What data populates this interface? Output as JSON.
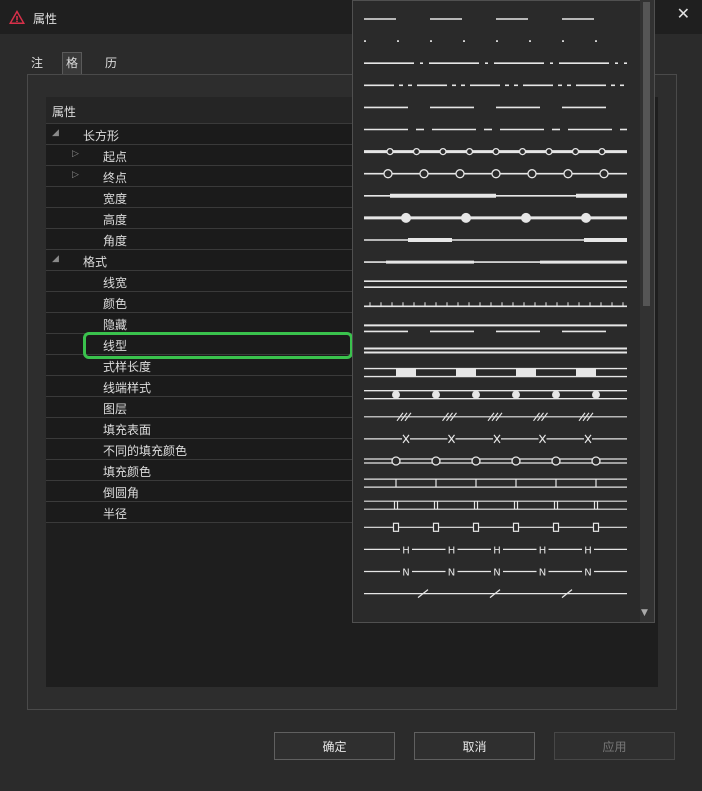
{
  "window": {
    "title": "属性",
    "close": "✕"
  },
  "tabs": [
    "注释",
    "格式",
    "历史记录"
  ],
  "grid": {
    "header": "属性",
    "rows": [
      {
        "label": "长方形",
        "indent": 0,
        "expander": "◢"
      },
      {
        "label": "起点",
        "indent": 1,
        "expander": "▷"
      },
      {
        "label": "终点",
        "indent": 1,
        "expander": "▷"
      },
      {
        "label": "宽度",
        "indent": 1,
        "expander": ""
      },
      {
        "label": "高度",
        "indent": 1,
        "expander": ""
      },
      {
        "label": "角度",
        "indent": 1,
        "expander": ""
      },
      {
        "label": "格式",
        "indent": 0,
        "expander": "◢"
      },
      {
        "label": "线宽",
        "indent": 1,
        "expander": ""
      },
      {
        "label": "颜色",
        "indent": 1,
        "expander": ""
      },
      {
        "label": "隐藏",
        "indent": 1,
        "expander": ""
      },
      {
        "label": "线型",
        "indent": 1,
        "expander": "",
        "highlighted": true
      },
      {
        "label": "式样长度",
        "indent": 1,
        "expander": ""
      },
      {
        "label": "线端样式",
        "indent": 1,
        "expander": ""
      },
      {
        "label": "图层",
        "indent": 1,
        "expander": ""
      },
      {
        "label": "填充表面",
        "indent": 1,
        "expander": ""
      },
      {
        "label": "不同的填充颜色",
        "indent": 1,
        "expander": ""
      },
      {
        "label": "填充颜色",
        "indent": 1,
        "expander": ""
      },
      {
        "label": "倒圆角",
        "indent": 1,
        "expander": ""
      },
      {
        "label": "半径",
        "indent": 1,
        "expander": ""
      }
    ]
  },
  "linetype_dropdown": {
    "item_count": 27,
    "styles": [
      "dash",
      "dot",
      "dash-dot",
      "dash-dot-dot",
      "long-dash",
      "long-dash-dot",
      "chain-dots",
      "circles",
      "thick-thin",
      "dot-bullets",
      "long-thick",
      "long-thin",
      "double",
      "ticks",
      "double-dash",
      "double-solid",
      "blocks",
      "bullets",
      "hatch",
      "x-marks",
      "circle-bullets",
      "bars",
      "double-bars",
      "boxes",
      "H-marks",
      "N-marks",
      "slashes"
    ]
  },
  "buttons": {
    "ok": "确定",
    "cancel": "取消",
    "apply": "应用"
  },
  "colors": {
    "highlight": "#3ac24d",
    "accent": "#e0314b"
  }
}
